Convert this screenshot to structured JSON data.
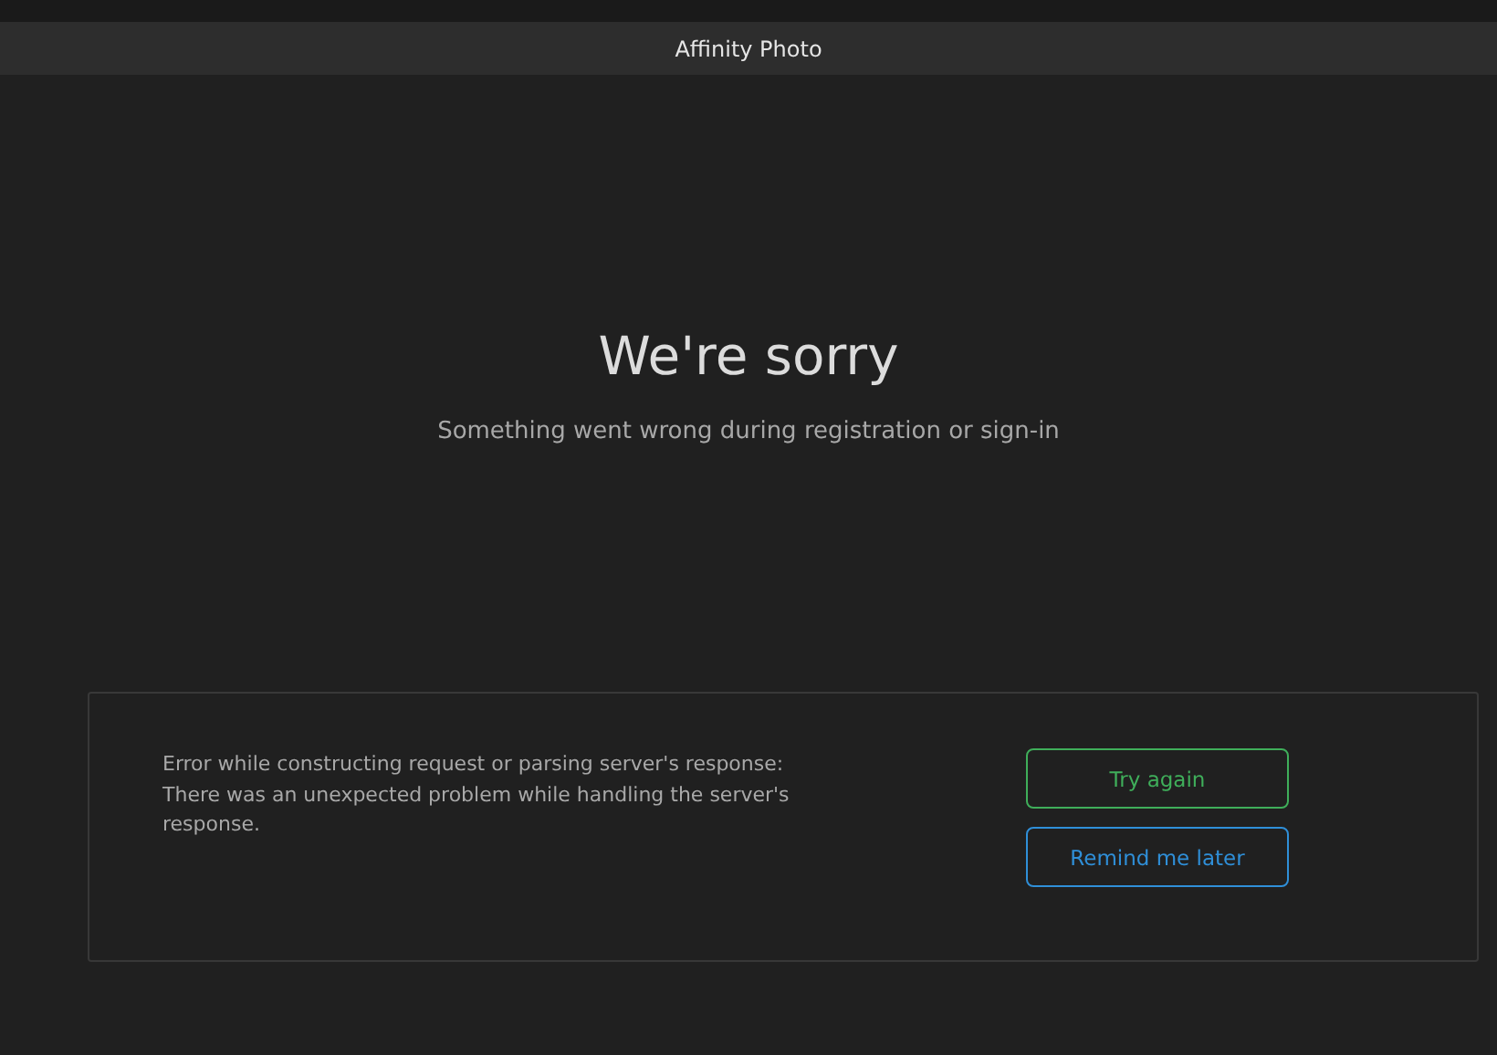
{
  "window": {
    "title": "Affinity Photo"
  },
  "heading": "We're sorry",
  "subtitle": "Something went wrong during registration or sign-in",
  "error_panel": {
    "message": "Error while constructing request or parsing server's response: There was an unexpected problem while handling the server's response.",
    "buttons": [
      {
        "label": "Try again",
        "color": "#3fae5a"
      },
      {
        "label": "Remind me later",
        "color": "#2f8fd8"
      }
    ]
  }
}
